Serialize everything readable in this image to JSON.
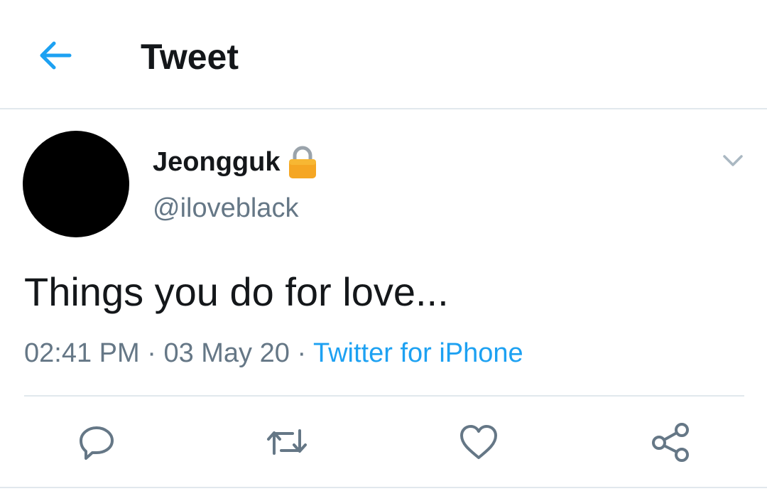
{
  "header": {
    "title": "Tweet",
    "back_icon": "arrow-left-icon"
  },
  "tweet": {
    "author": {
      "display_name": "Jeongguk",
      "handle": "@iloveblack",
      "protected_icon": "lock-icon",
      "avatar_color": "#000000"
    },
    "text": "Things you do for love...",
    "time": "02:41 PM",
    "separator": "·",
    "date": "03 May 20",
    "source": "Twitter for iPhone",
    "menu_icon": "chevron-down-icon"
  },
  "actions": [
    {
      "name": "reply",
      "icon": "reply-icon"
    },
    {
      "name": "retweet",
      "icon": "retweet-icon"
    },
    {
      "name": "like",
      "icon": "heart-icon"
    },
    {
      "name": "share",
      "icon": "share-icon"
    }
  ],
  "colors": {
    "accent": "#1da1f2",
    "secondary_text": "#657786",
    "primary_text": "#14171a",
    "divider": "#e1e8ed",
    "icon": "#657786"
  }
}
